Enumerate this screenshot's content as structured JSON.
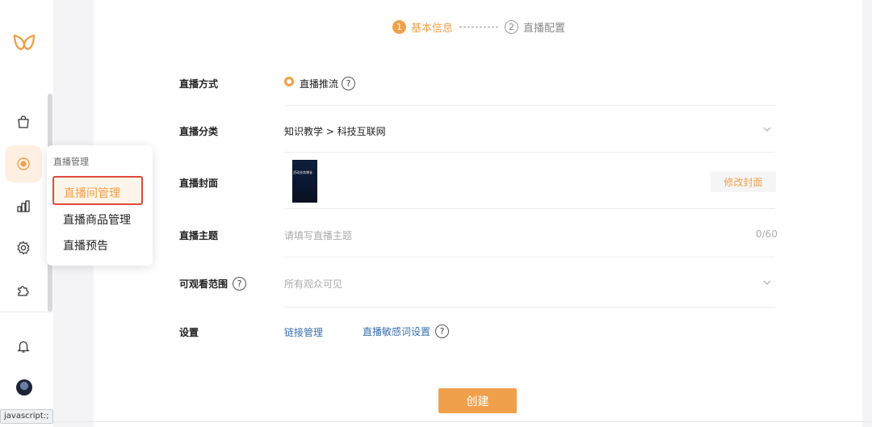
{
  "nav": {
    "items": [
      "bag-icon",
      "live-icon",
      "chart-icon",
      "gear-icon",
      "puzzle-icon"
    ],
    "footer_items": [
      "bell-icon",
      "avatar"
    ],
    "accent": "#f0a04b"
  },
  "flyout": {
    "title": "直播管理",
    "items": [
      "直播间管理",
      "直播商品管理",
      "直播预告"
    ]
  },
  "stepper": {
    "step1_number": "1",
    "step1_label": "基本信息",
    "step2_number": "2",
    "step2_label": "直播配置"
  },
  "form": {
    "method_label": "直播方式",
    "method_value": "直播推流",
    "category_label": "直播分类",
    "category_value": "知识教学 > 科技互联网",
    "cover_label": "直播封面",
    "cover_image_text": "活动业务增长",
    "cover_button": "修改封面",
    "topic_label": "直播主题",
    "topic_placeholder": "请填写直播主题",
    "topic_counter": "0/60",
    "visibility_label": "可观看范围",
    "visibility_placeholder": "所有观众可见",
    "settings_label": "设置",
    "settings_link1": "链接管理",
    "settings_link2": "直播敏感词设置",
    "help_glyph": "?"
  },
  "actions": {
    "create_label": "创建"
  },
  "status_bar": {
    "text": "javascript:;"
  }
}
